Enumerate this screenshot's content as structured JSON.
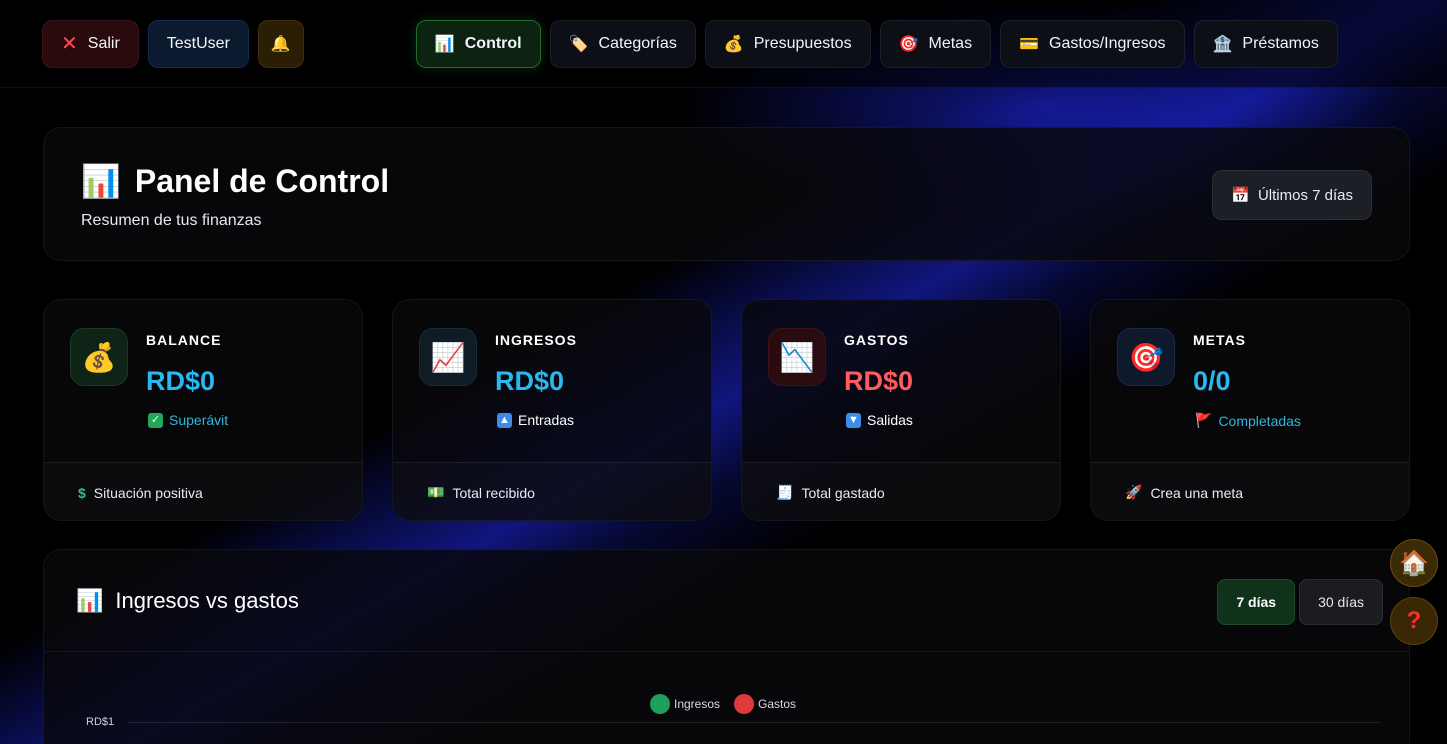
{
  "nav": {
    "salir_label": "Salir",
    "user_label": "TestUser",
    "items": [
      {
        "icon": "📊",
        "label": "Control",
        "active": true
      },
      {
        "icon": "🏷️",
        "label": "Categorías",
        "active": false
      },
      {
        "icon": "💰",
        "label": "Presupuestos",
        "active": false
      },
      {
        "icon": "🎯",
        "label": "Metas",
        "active": false
      },
      {
        "icon": "💳",
        "label": "Gastos/Ingresos",
        "active": false
      },
      {
        "icon": "🏦",
        "label": "Préstamos",
        "active": false
      }
    ]
  },
  "header": {
    "title": "Panel de Control",
    "subtitle": "Resumen de tus finanzas",
    "range_label": "Últimos 7 días"
  },
  "stats": [
    {
      "label": "BALANCE",
      "value": "RD$0",
      "value_color": "#2ab8f0",
      "tag": "Superávit",
      "tag_color": "#2fb6d8",
      "footer": "Situación positiva"
    },
    {
      "label": "INGRESOS",
      "value": "RD$0",
      "value_color": "#2ab8f0",
      "tag": "Entradas",
      "tag_color": "#ffffff",
      "footer": "Total recibido"
    },
    {
      "label": "GASTOS",
      "value": "RD$0",
      "value_color": "#ff5b61",
      "tag": "Salidas",
      "tag_color": "#ffffff",
      "footer": "Total gastado"
    },
    {
      "label": "METAS",
      "value": "0/0",
      "value_color": "#2ab8f0",
      "tag": "Completadas",
      "tag_color": "#2fb6d8",
      "footer": "Crea una meta"
    }
  ],
  "chart": {
    "title": "Ingresos vs gastos",
    "tabs": [
      "7 días",
      "30 días"
    ],
    "active_tab": "7 días"
  },
  "chart_data": {
    "type": "line",
    "series": [
      {
        "name": "Ingresos",
        "color": "#1fa05a",
        "values": []
      },
      {
        "name": "Gastos",
        "color": "#e03a3a",
        "values": []
      }
    ],
    "y_ticks": [
      "RD$1"
    ]
  }
}
